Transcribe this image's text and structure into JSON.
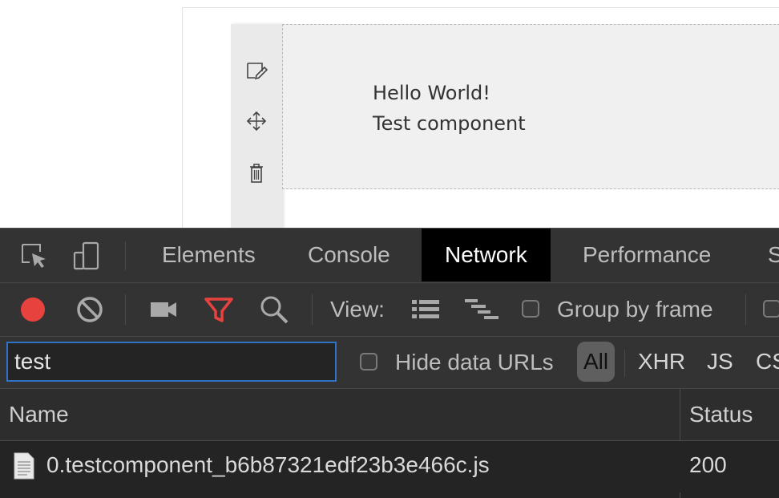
{
  "component": {
    "line1": "Hello World!",
    "line2": "Test component"
  },
  "editor_tools": [
    {
      "icon": "edit-icon"
    },
    {
      "icon": "move-icon"
    },
    {
      "icon": "trash-icon"
    }
  ],
  "devtools": {
    "tabs": [
      "Elements",
      "Console",
      "Network",
      "Performance",
      "S"
    ],
    "active_tab": "Network",
    "controls": {
      "view_label": "View:",
      "group_by_frame_label": "Group by frame"
    },
    "filter": {
      "value": "test",
      "hide_data_urls_label": "Hide data URLs",
      "types": [
        "All",
        "XHR",
        "JS",
        "CS"
      ],
      "active_type": "All"
    },
    "table": {
      "columns": [
        "Name",
        "Status"
      ],
      "rows": [
        {
          "name": "0.testcomponent_b6b87321edf23b3e466c.js",
          "status": "200"
        }
      ]
    }
  },
  "colors": {
    "record": "#e8423f",
    "filter_active": "#e8423f",
    "focus_border": "#2e73c5",
    "devtools_bg": "#333333",
    "active_tab_bg": "#000000"
  }
}
